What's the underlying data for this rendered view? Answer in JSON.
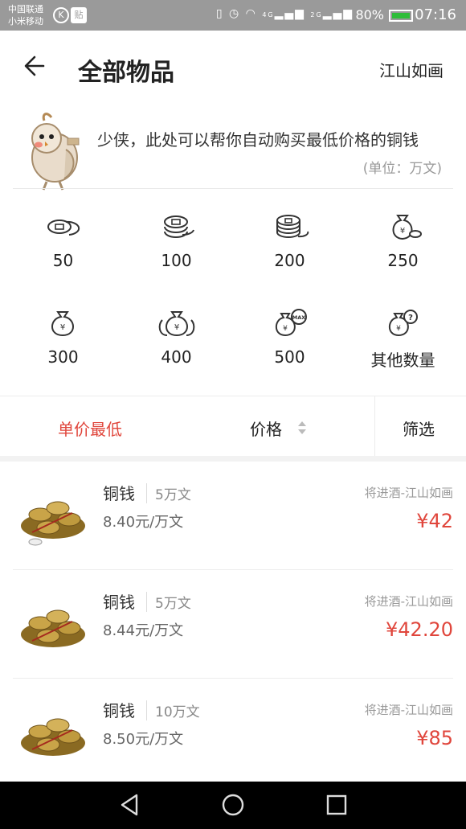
{
  "status_bar": {
    "carrier_1": "中国联通",
    "carrier_2": "小米移动",
    "badge_k": "K",
    "badge_tie": "贴",
    "network_4g": "4G",
    "network_2g": "2G",
    "battery": "80%",
    "time": "07:16"
  },
  "header": {
    "title": "全部物品",
    "game": "江山如画"
  },
  "intro": {
    "text": "少侠，此处可以帮你自动购买最低价格的铜钱",
    "unit_note": "(单位：万文)"
  },
  "amounts": [
    {
      "label": "50",
      "icon": "coins-small-icon"
    },
    {
      "label": "100",
      "icon": "coins-stack-icon"
    },
    {
      "label": "200",
      "icon": "coins-pile-icon"
    },
    {
      "label": "250",
      "icon": "money-bag-icon"
    },
    {
      "label": "300",
      "icon": "money-bag-icon"
    },
    {
      "label": "400",
      "icon": "money-bags-icon"
    },
    {
      "label": "500",
      "icon": "money-bag-max-icon"
    },
    {
      "label": "其他数量",
      "icon": "money-bag-question-icon"
    }
  ],
  "filters": {
    "lowest_unit": "单价最低",
    "price": "价格",
    "screen": "筛选"
  },
  "listings": [
    {
      "name": "铜钱",
      "quantity": "5万文",
      "unit_price": "8.40元/万文",
      "seller": "将进酒-江山如画",
      "price": "¥42"
    },
    {
      "name": "铜钱",
      "quantity": "5万文",
      "unit_price": "8.44元/万文",
      "seller": "将进酒-江山如画",
      "price": "¥42.20"
    },
    {
      "name": "铜钱",
      "quantity": "10万文",
      "unit_price": "8.50元/万文",
      "seller": "将进酒-江山如画",
      "price": "¥85"
    }
  ],
  "colors": {
    "accent": "#e0463c",
    "status_bar": "#9a9a9a",
    "battery_fill": "#2fbd3a"
  }
}
